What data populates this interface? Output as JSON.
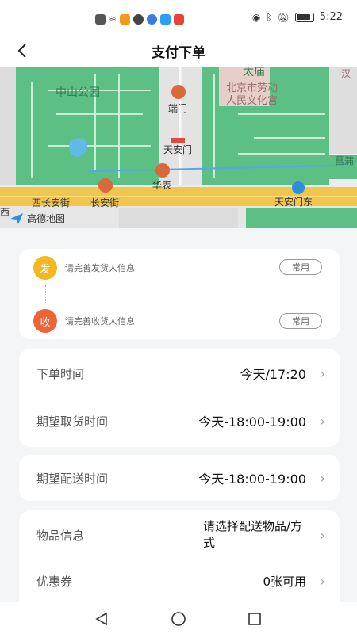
{
  "status_bar": {
    "time": "5:22",
    "icons": [
      "notification-icon",
      "wifi-icon",
      "app-icon",
      "browser-icon",
      "app-icon",
      "search-app-icon",
      "message-icon"
    ]
  },
  "nav": {
    "title": "支付下单"
  },
  "map": {
    "labels": {
      "zhongshan_park": "中山公园",
      "taimiao": "太庙",
      "duanmen": "端门",
      "labor_palace_1": "北京市劳动",
      "labor_palace_2": "人民文化宫",
      "tiananmen": "天安门",
      "huabiao": "华表",
      "west_changan": "西长安街",
      "changan_jie": "长安街",
      "tiananmen_east": "天安门东",
      "west": "西",
      "puqing": "菖蒲",
      "han": "汉",
      "amap": "高德地图"
    },
    "colors": {
      "park": "#5cbf84",
      "road": "#f2c64b"
    }
  },
  "address": {
    "sender_badge": "发",
    "sender_text": "请完善发货人信息",
    "sender_color": "#f3b81f",
    "receiver_badge": "收",
    "receiver_text": "请完善收货人信息",
    "receiver_color": "#ee6437",
    "common_label": "常用"
  },
  "order_time": {
    "label": "下单时间",
    "value": "今天/17:20"
  },
  "pickup_time": {
    "label": "期望取货时间",
    "value": "今天-18:00-19:00"
  },
  "delivery_time": {
    "label": "期望配送时间",
    "value": "今天-18:00-19:00"
  },
  "goods": {
    "label": "物品信息",
    "value": "请选择配送物品/方式"
  },
  "coupon": {
    "label": "优惠券",
    "value": "0张可用"
  },
  "chevron": "›"
}
